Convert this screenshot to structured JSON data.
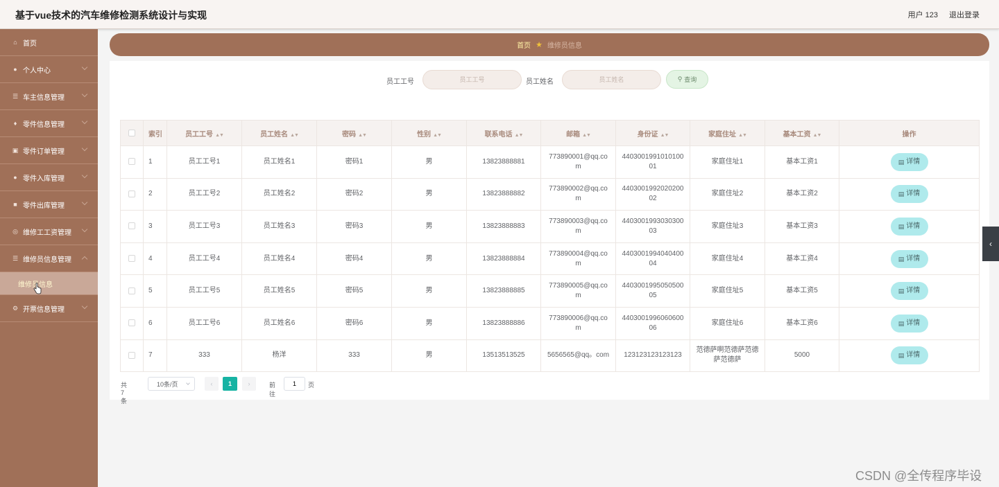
{
  "header": {
    "title": "基于vue技术的汽车维修检测系统设计与实现",
    "user": "用户 123",
    "logout": "退出登录"
  },
  "sidebar": {
    "items": [
      {
        "label": "首页",
        "icon": "home-icon",
        "glyph": "⌂"
      },
      {
        "label": "个人中心",
        "icon": "user-icon",
        "glyph": "●"
      },
      {
        "label": "车主信息管理",
        "icon": "list-icon",
        "glyph": "☰"
      },
      {
        "label": "零件信息管理",
        "icon": "thumb-icon",
        "glyph": "♦"
      },
      {
        "label": "零件订单管理",
        "icon": "order-icon",
        "glyph": "▣"
      },
      {
        "label": "零件入库管理",
        "icon": "location-icon",
        "glyph": "●"
      },
      {
        "label": "零件出库管理",
        "icon": "box-icon",
        "glyph": "■"
      },
      {
        "label": "维修工工资管理",
        "icon": "wage-icon",
        "glyph": "◎"
      },
      {
        "label": "维修员信息管理",
        "icon": "menu-icon",
        "glyph": "☰"
      },
      {
        "label": "维修员信息"
      },
      {
        "label": "开票信息管理",
        "icon": "gear-icon",
        "glyph": "⚙"
      }
    ]
  },
  "breadcrumb": {
    "home": "首页",
    "current": "维修员信息"
  },
  "search": {
    "label1": "员工工号",
    "placeholder1": "员工工号",
    "label2": "员工姓名",
    "placeholder2": "员工姓名",
    "button": "查询"
  },
  "table": {
    "headers": [
      "索引",
      "员工工号",
      "员工姓名",
      "密码",
      "性别",
      "联系电话",
      "邮箱",
      "身份证",
      "家庭住址",
      "基本工资",
      "操作"
    ],
    "rows": [
      [
        "1",
        "员工工号1",
        "员工姓名1",
        "密码1",
        "男",
        "13823888881",
        "773890001@qq.com",
        "440300199101010001",
        "家庭住址1",
        "基本工资1"
      ],
      [
        "2",
        "员工工号2",
        "员工姓名2",
        "密码2",
        "男",
        "13823888882",
        "773890002@qq.com",
        "440300199202020002",
        "家庭住址2",
        "基本工资2"
      ],
      [
        "3",
        "员工工号3",
        "员工姓名3",
        "密码3",
        "男",
        "13823888883",
        "773890003@qq.com",
        "440300199303030003",
        "家庭住址3",
        "基本工资3"
      ],
      [
        "4",
        "员工工号4",
        "员工姓名4",
        "密码4",
        "男",
        "13823888884",
        "773890004@qq.com",
        "440300199404040004",
        "家庭住址4",
        "基本工资4"
      ],
      [
        "5",
        "员工工号5",
        "员工姓名5",
        "密码5",
        "男",
        "13823888885",
        "773890005@qq.com",
        "440300199505050005",
        "家庭住址5",
        "基本工资5"
      ],
      [
        "6",
        "员工工号6",
        "员工姓名6",
        "密码6",
        "男",
        "13823888886",
        "773890006@qq.com",
        "440300199606060006",
        "家庭住址6",
        "基本工资6"
      ],
      [
        "7",
        "333",
        "杨洋",
        "333",
        "男",
        "13513513525",
        "5656565@qq。com",
        "123123123123123",
        "范德萨啊范德萨范德萨范德萨",
        "5000"
      ]
    ],
    "detail_label": "详情"
  },
  "pagination": {
    "total": "共 7 条",
    "page_size": "10条/页",
    "current": "1",
    "goto": "前往",
    "goto_value": "1",
    "page": "页"
  },
  "watermark": "CSDN @全传程序毕设",
  "colors": {
    "sidebar": "#a07058",
    "accent": "#17b3a3",
    "detail": "#afeaec"
  }
}
